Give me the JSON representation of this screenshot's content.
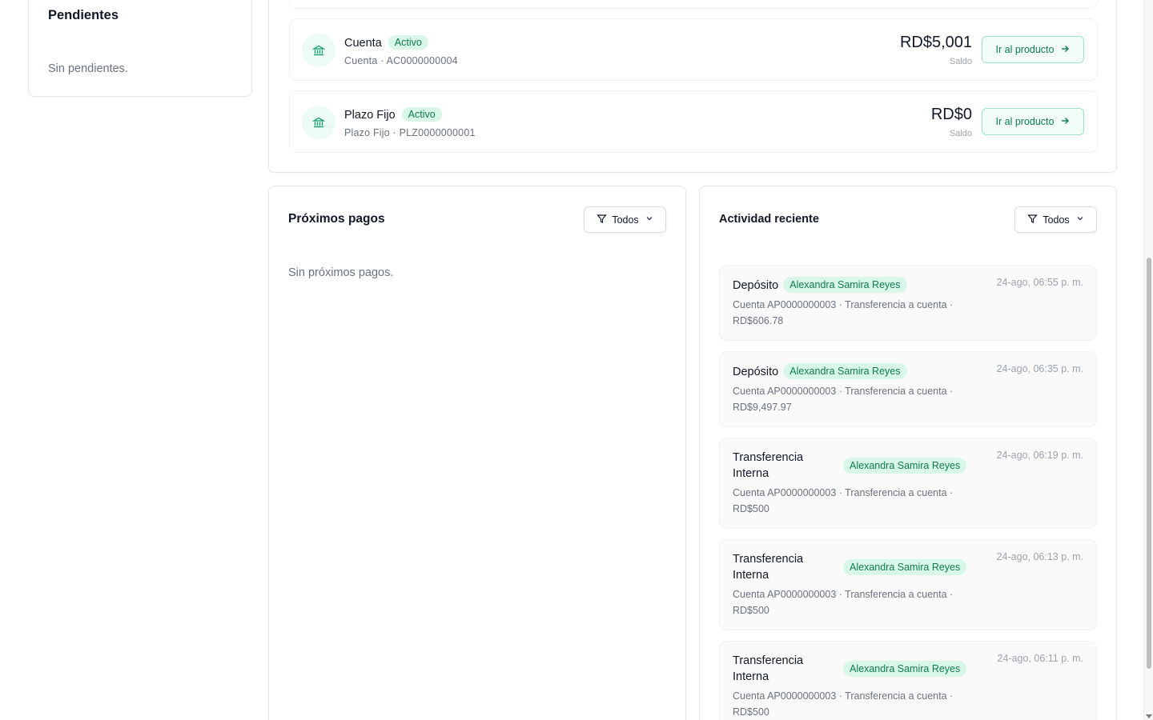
{
  "pending": {
    "title": "Pendientes",
    "empty_text": "Sin pendientes."
  },
  "products": [
    {
      "name": "Cuenta",
      "status": "Activo",
      "subtitle": "Cuenta · AC0000000004",
      "amount": "RD$5,001",
      "amount_label": "Saldo",
      "action_label": "Ir al producto",
      "icon": "bank-icon"
    },
    {
      "name": "Plazo Fijo",
      "status": "Activo",
      "subtitle": "Plazo Fijo · PLZ0000000001",
      "amount": "RD$0",
      "amount_label": "Saldo",
      "action_label": "Ir al producto",
      "icon": "bank-icon"
    }
  ],
  "upcoming_payments": {
    "title": "Próximos pagos",
    "filter_label": "Todos",
    "empty_text": "Sin próximos pagos."
  },
  "recent_activity": {
    "title": "Actividad reciente",
    "filter_label": "Todos",
    "items": [
      {
        "type": "Depósito",
        "person": "Alexandra Samira Reyes",
        "time": "24-ago, 06:55 p. m.",
        "description": "Cuenta AP0000000003 · Transferencia a cuenta · RD$606.78"
      },
      {
        "type": "Depósito",
        "person": "Alexandra Samira Reyes",
        "time": "24-ago, 06:35 p. m.",
        "description": "Cuenta AP0000000003 · Transferencia a cuenta · RD$9,497.97"
      },
      {
        "type": "Transferencia Interna",
        "person": "Alexandra Samira Reyes",
        "time": "24-ago, 06:19 p. m.",
        "description": "Cuenta AP0000000003 · Transferencia a cuenta · RD$500"
      },
      {
        "type": "Transferencia Interna",
        "person": "Alexandra Samira Reyes",
        "time": "24-ago, 06:13 p. m.",
        "description": "Cuenta AP0000000003 · Transferencia a cuenta · RD$500"
      },
      {
        "type": "Transferencia Interna",
        "person": "Alexandra Samira Reyes",
        "time": "24-ago, 06:11 p. m.",
        "description": "Cuenta AP0000000003 · Transferencia a cuenta · RD$500"
      }
    ]
  },
  "colors": {
    "accent": "#10996b",
    "badge_bg": "#d9f7e9",
    "badge_text": "#0f7a52"
  }
}
